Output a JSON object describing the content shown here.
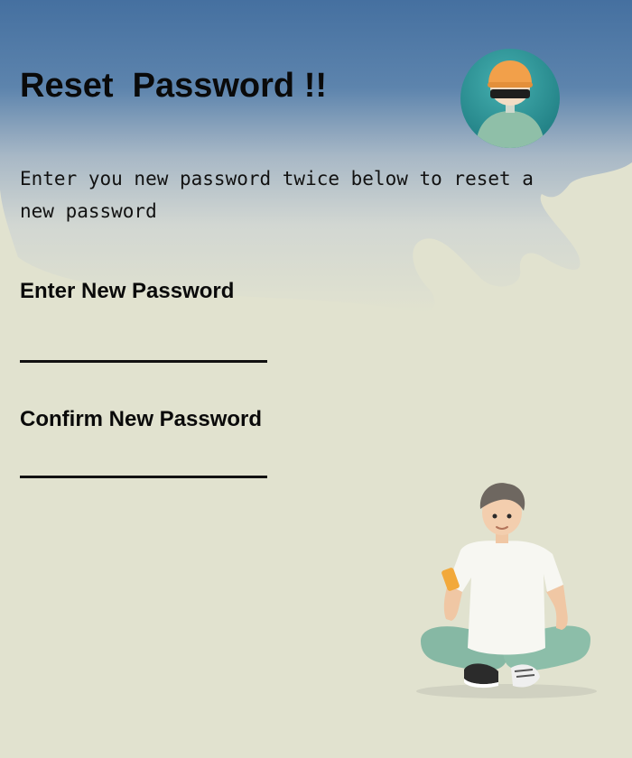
{
  "header": {
    "title": "Reset  Password !!",
    "subtitle": "Enter you new password twice below to reset a new password"
  },
  "form": {
    "new_password_label": "Enter New Password",
    "new_password_value": "",
    "confirm_password_label": "Confirm New Password",
    "confirm_password_value": ""
  },
  "colors": {
    "header_blue": "#4673a3",
    "background": "#e1e2cf",
    "text": "#0a0a0a",
    "avatar_teal": "#2f9597"
  },
  "icons": {
    "avatar": "user-avatar-icon",
    "illustration": "person-with-phone-illustration"
  }
}
